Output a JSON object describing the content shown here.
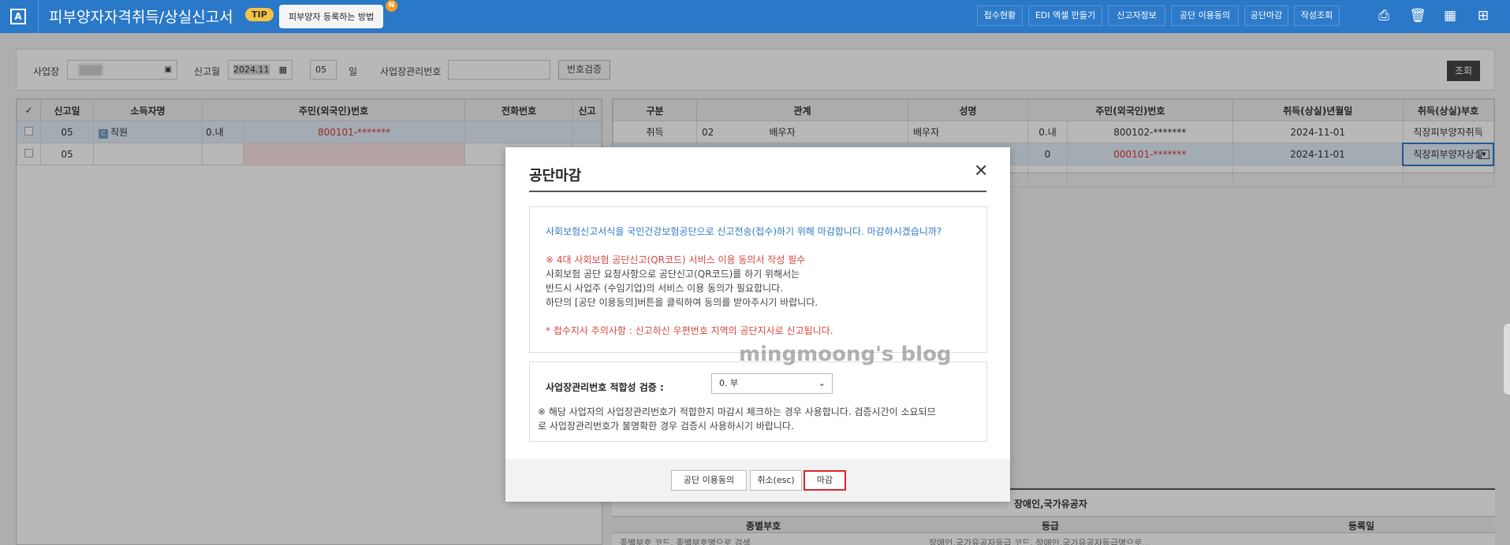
{
  "header": {
    "app_title": "피부양자자격취득/상실신고서",
    "tip_badge": "TIP",
    "tip_text": "피부양자 등록하는 방법",
    "tip_new": "N",
    "buttons": [
      "접수현황",
      "EDI 엑셀 만들기",
      "신고자정보",
      "공단 이용동의",
      "공단마감",
      "작성조회"
    ],
    "icons": [
      "print-icon",
      "trash-icon",
      "calculator-icon",
      "grid-menu-icon"
    ]
  },
  "search": {
    "workplace_label": "사업장",
    "report_month_label": "신고월",
    "report_month_value": "2024.11",
    "day_value": "05",
    "day_label": "일",
    "workplace_no_label": "사업장관리번호",
    "verify_button": "번호검증",
    "search_button": "조회"
  },
  "left_grid": {
    "headers": [
      "신고일",
      "소득자명",
      "주민(외국인)번호",
      "",
      "전화번호",
      "신고"
    ],
    "rows": [
      {
        "date": "05",
        "tag": "C",
        "name": "직원",
        "foreign": "0.내",
        "rrn": "800101-*******"
      },
      {
        "date": "05",
        "tag": "",
        "name": "",
        "foreign": "",
        "rrn": ""
      }
    ]
  },
  "right_grid": {
    "headers": [
      "구분",
      "관계",
      "",
      "성명",
      "주민(외국인)번호",
      "",
      "취득(상실)년월일",
      "취득(상실)부호"
    ],
    "rows": [
      {
        "type": "취득",
        "rel_code": "02",
        "rel_name": "배우자",
        "name": "배우자",
        "foreign": "0.내",
        "rrn": "800102-*******",
        "date": "2024-11-01",
        "code": "직장피부양자취득"
      },
      {
        "type": "",
        "rel_code": "",
        "rel_name": "",
        "name": "",
        "foreign": "0",
        "rrn": "000101-*******",
        "date": "2024-11-01",
        "code": "직장피부양자상실"
      }
    ]
  },
  "bottom_panel": {
    "title": "장애인,국가유공자",
    "headers": [
      "종별부호",
      "등급",
      "등록일"
    ],
    "row_hint_1": "종별부호 코드, 종별부호명으로 검색",
    "row_hint_2": "장애인,국가유공자등급 코드, 장애인,국가유공자등급명으로..."
  },
  "modal": {
    "title": "공단마감",
    "notice_line_1": "사회보험신고서식을 국민건강보험공단으로 신고전송(접수)하기 위해 마감합니다. 마감하시겠습니까?",
    "notice_line_2": "※ 4대 사회보험 공단신고(QR코드) 서비스 이용 동의서 작성 필수",
    "notice_line_3": "사회보험 공단 요청사항으로 공단신고(QR코드)를 하기 위해서는",
    "notice_line_4": "반드시 사업주 (수임기업)의 서비스 이용 동의가 필요합니다.",
    "notice_line_5": "하단의 [공단 이용동의]버튼을 클릭하여 동의를 받아주시기 바랍니다.",
    "notice_line_6": "* 접수지사 주의사항 : 신고하신 우편번호 지역의 공단지사로 신고됩니다.",
    "verify_label": "사업장관리번호 적합성 검증 :",
    "verify_value": "0. 부",
    "verify_note_1": "※ 해당 사업자의 사업장관리번호가 적합한지 마감시 체크하는 경우 사용합니다. 검증시간이 소요되므",
    "verify_note_2": "로 사업장관리번호가 불명확한 경우 검증시 사용하시기 바랍니다.",
    "btn_consent": "공단 이용동의",
    "btn_cancel": "취소(esc)",
    "btn_close": "마감"
  },
  "watermark": "mingmoong's blog"
}
